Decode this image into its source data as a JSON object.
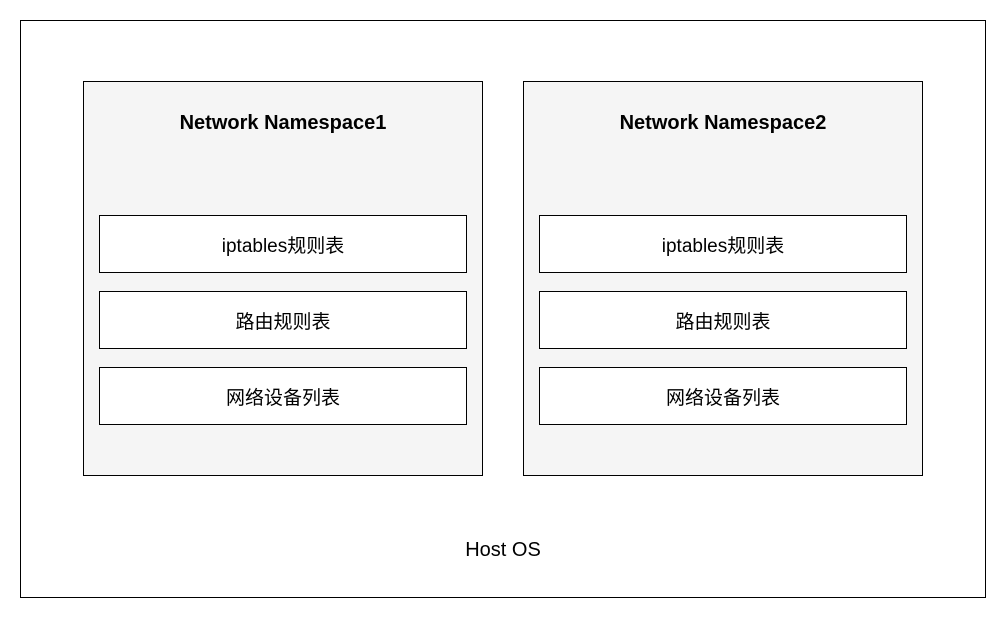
{
  "host_os_label": "Host OS",
  "namespaces": [
    {
      "title": "Network Namespace1",
      "items": [
        "iptables规则表",
        "路由规则表",
        "网络设备列表"
      ]
    },
    {
      "title": "Network Namespace2",
      "items": [
        "iptables规则表",
        "路由规则表",
        "网络设备列表"
      ]
    }
  ]
}
